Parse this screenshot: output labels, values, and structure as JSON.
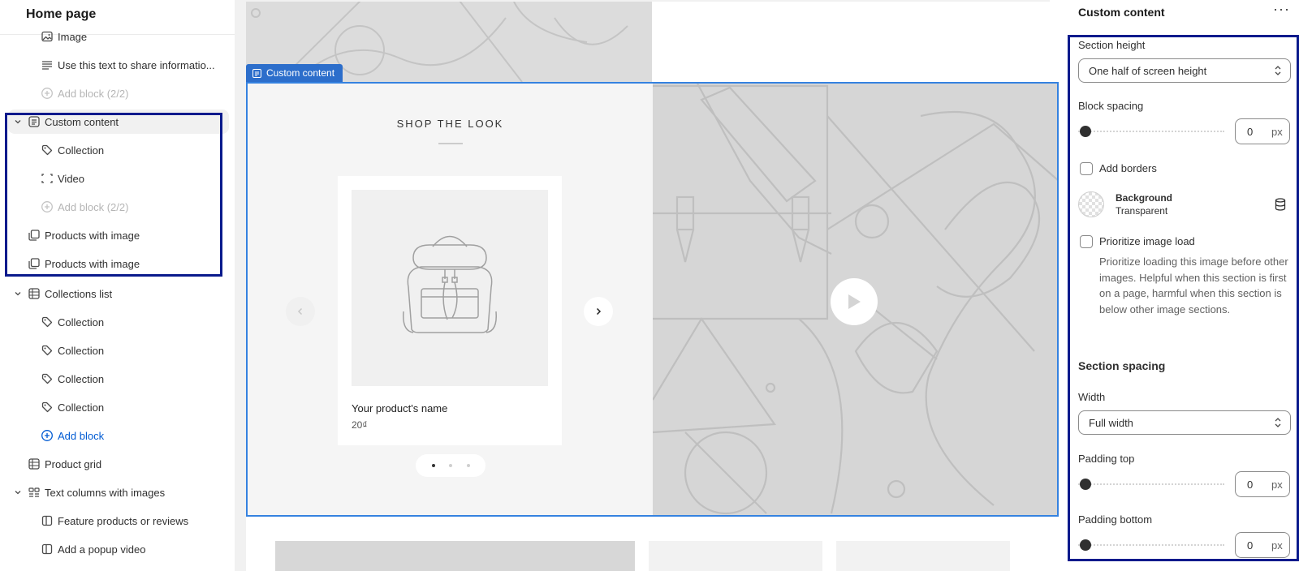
{
  "sidebar": {
    "title": "Home page",
    "items": [
      {
        "label": "Image",
        "icon": "image-icon"
      },
      {
        "label": "Use this text to share informatio...",
        "icon": "text-icon"
      },
      {
        "label": "Add block (2/2)",
        "icon": "plus-circle-icon"
      },
      {
        "label": "Custom content",
        "icon": "custom-content-icon"
      },
      {
        "label": "Collection",
        "icon": "tag-icon"
      },
      {
        "label": "Video",
        "icon": "video-frame-icon"
      },
      {
        "label": "Add block (2/2)",
        "icon": "plus-circle-icon"
      },
      {
        "label": "Products with image",
        "icon": "products-icon"
      },
      {
        "label": "Products with image",
        "icon": "products-icon"
      },
      {
        "label": "Collections list",
        "icon": "list-icon"
      },
      {
        "label": "Collection",
        "icon": "tag-icon"
      },
      {
        "label": "Collection",
        "icon": "tag-icon"
      },
      {
        "label": "Collection",
        "icon": "tag-icon"
      },
      {
        "label": "Collection",
        "icon": "tag-icon"
      },
      {
        "label": "Add block",
        "icon": "plus-circle-icon"
      },
      {
        "label": "Product grid",
        "icon": "list-icon"
      },
      {
        "label": "Text columns with images",
        "icon": "columns-icon"
      },
      {
        "label": "Feature products or reviews",
        "icon": "column-icon"
      },
      {
        "label": "Add a popup video",
        "icon": "column-icon"
      }
    ]
  },
  "preview": {
    "section_tag": "Custom content",
    "shop_title": "SHOP THE LOOK",
    "product_name": "Your product's name",
    "product_price": "20₫"
  },
  "settings": {
    "title": "Custom content",
    "section_height_label": "Section height",
    "section_height_value": "One half of screen height",
    "block_spacing_label": "Block spacing",
    "block_spacing_value": "0",
    "unit": "px",
    "add_borders_label": "Add borders",
    "background_title": "Background",
    "background_value": "Transparent",
    "prioritize_label": "Prioritize image load",
    "prioritize_help": "Prioritize loading this image before other images. Helpful when this section is first on a page, harmful when this section is below other image sections.",
    "section_spacing_heading": "Section spacing",
    "width_label": "Width",
    "width_value": "Full width",
    "padding_top_label": "Padding top",
    "padding_top_value": "0",
    "padding_bottom_label": "Padding bottom",
    "padding_bottom_value": "0"
  },
  "colors": {
    "highlight": "#0a1a8c",
    "selection_outline": "#3582e0",
    "link": "#005bd3"
  }
}
